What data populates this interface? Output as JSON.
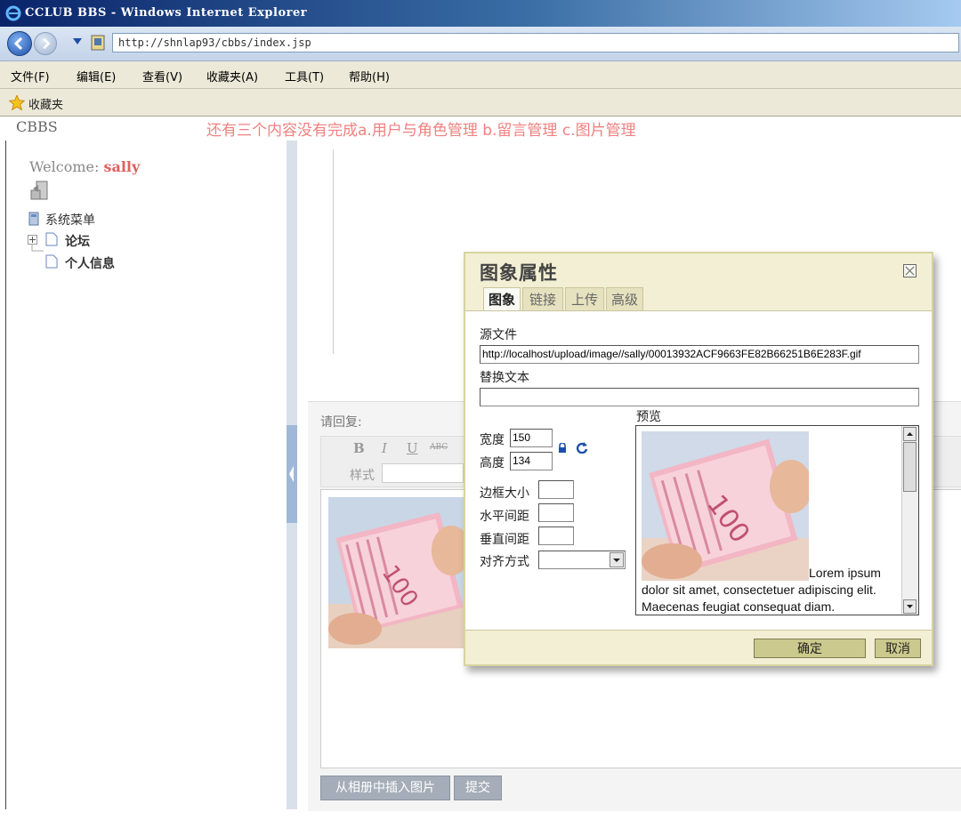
{
  "browser": {
    "title": "CCLUB BBS - Windows Internet Explorer",
    "url": "http://shnlap93/cbbs/index.jsp",
    "menu": [
      "文件(F)",
      "编辑(E)",
      "查看(V)",
      "收藏夹(A)",
      "工具(T)",
      "帮助(H)"
    ],
    "favorites_label": "收藏夹"
  },
  "page": {
    "logo": "CBBS",
    "note": "还有三个内容没有完成a.用户与角色管理 b.留言管理 c.图片管理",
    "welcome_prefix": "Welcome:",
    "username": "sally",
    "tree": {
      "root": "系统菜单",
      "items": [
        "论坛",
        "个人信息"
      ]
    },
    "reply_label": "请回复:",
    "toolbar": {
      "bold": "B",
      "italic": "I",
      "underline": "U",
      "strike": "ABC",
      "style_label": "样式"
    },
    "buttons": {
      "insert_album": "从相册中插入图片",
      "submit": "提交"
    }
  },
  "dialog": {
    "title": "图象属性",
    "tabs": [
      "图象",
      "链接",
      "上传",
      "高级"
    ],
    "active_tab": "图象",
    "source_label": "源文件",
    "source_value": "http://localhost/upload/image//sally/00013932ACF9663FE82B66251B6E283F.gif",
    "alt_label": "替换文本",
    "alt_value": "",
    "width_label": "宽度",
    "width_value": "150",
    "height_label": "高度",
    "height_value": "134",
    "border_label": "边框大小",
    "hspace_label": "水平间距",
    "vspace_label": "垂直间距",
    "align_label": "对齐方式",
    "align_value": "",
    "preview_label": "预览",
    "preview_text": "Lorem ipsum dolor sit amet, consectetuer adipiscing elit. Maecenas feugiat consequat diam.",
    "ok": "确定",
    "cancel": "取消"
  },
  "icons": [
    "ie-logo-icon",
    "back-icon",
    "forward-icon",
    "dropdown-icon",
    "page-icon",
    "star-icon",
    "exit-icon",
    "computer-icon",
    "expand-icon",
    "document-icon",
    "lock-icon",
    "reset-icon",
    "close-icon",
    "scroll-up-icon",
    "scroll-down-icon",
    "select-arrow-icon"
  ],
  "colors": {
    "note": "#f08080",
    "username": "#e06060",
    "dialog_bg": "#f2efd4",
    "title_bar": "#0a246a"
  }
}
